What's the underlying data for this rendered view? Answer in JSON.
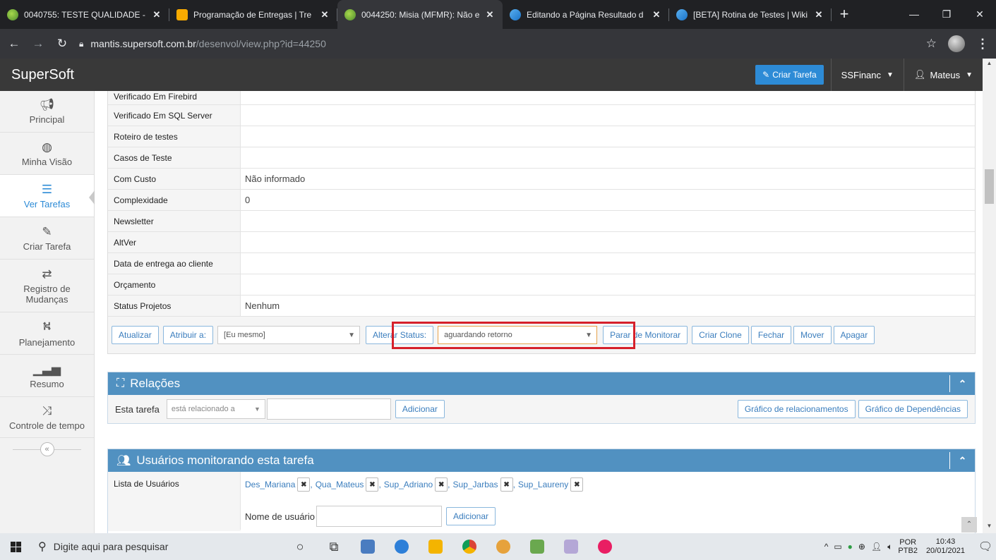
{
  "browser": {
    "tabs": [
      {
        "title": "0040755: TESTE QUALIDADE - N",
        "favicon": "mantis-icon"
      },
      {
        "title": "Programação de Entregas | Tre",
        "favicon": "trello-icon"
      },
      {
        "title": "0044250: Misia (MFMR): Não e",
        "favicon": "mantis-icon",
        "active": true
      },
      {
        "title": "Editando a Página Resultado d",
        "favicon": "wiki-icon"
      },
      {
        "title": "[BETA] Rotina de Testes | Wiki",
        "favicon": "wiki-icon"
      }
    ],
    "new_tab": "+",
    "url_host": "mantis.supersoft.com.br",
    "url_path": "/desenvol/view.php?id=44250"
  },
  "navbar": {
    "brand": "SuperSoft",
    "create_button": "Criar Tarefa",
    "project": "SSFinanc",
    "user": "Mateus"
  },
  "sidebar": {
    "items": [
      {
        "label": "Principal",
        "icon": "megaphone-icon"
      },
      {
        "label": "Minha Visão",
        "icon": "dashboard-icon"
      },
      {
        "label": "Ver Tarefas",
        "icon": "list-icon",
        "active": true
      },
      {
        "label": "Criar Tarefa",
        "icon": "edit-icon"
      },
      {
        "label": "Registro de Mudanças",
        "icon": "retweet-icon"
      },
      {
        "label": "Planejamento",
        "icon": "road-icon"
      },
      {
        "label": "Resumo",
        "icon": "bar-chart-icon"
      },
      {
        "label": "Controle de tempo",
        "icon": "random-icon"
      }
    ]
  },
  "details": {
    "rows": [
      {
        "label": "Verificado Em Firebird",
        "value": ""
      },
      {
        "label": "Verificado Em SQL Server",
        "value": ""
      },
      {
        "label": "Roteiro de testes",
        "value": ""
      },
      {
        "label": "Casos de Teste",
        "value": ""
      },
      {
        "label": "Com Custo",
        "value": "Não informado"
      },
      {
        "label": "Complexidade",
        "value": "0"
      },
      {
        "label": "Newsletter",
        "value": ""
      },
      {
        "label": "AltVer",
        "value": ""
      },
      {
        "label": "Data de entrega ao cliente",
        "value": ""
      },
      {
        "label": "Orçamento",
        "value": ""
      },
      {
        "label": "Status Projetos",
        "value": "Nenhum"
      }
    ]
  },
  "actions": {
    "update": "Atualizar",
    "assign": "Atribuir a:",
    "assign_value": "[Eu mesmo]",
    "change_status": "Alterar Status:",
    "status_value": "aguardando retorno",
    "stop_monitor": "Parar de Monitorar",
    "clone": "Criar Clone",
    "close": "Fechar",
    "move": "Mover",
    "delete": "Apagar",
    "highlight_color": "#d6202b"
  },
  "relations": {
    "title": "Relações",
    "label": "Esta tarefa",
    "select_value": "está relacionado a",
    "add": "Adicionar",
    "graph_relations": "Gráfico de relacionamentos",
    "graph_dependencies": "Gráfico de Dependências"
  },
  "monitors": {
    "title": "Usuários monitorando esta tarefa",
    "list_label": "Lista de Usuários",
    "users": [
      "Des_Mariana",
      "Qua_Mateus",
      "Sup_Adriano",
      "Sup_Jarbas",
      "Sup_Laureny"
    ],
    "username_label": "Nome de usuário",
    "add": "Adicionar"
  },
  "taskbar": {
    "search_placeholder": "Digite aqui para pesquisar",
    "lang_line1": "POR",
    "lang_line2": "PTB2",
    "time": "10:43",
    "date": "20/01/2021"
  },
  "colors": {
    "accent": "#2d8bd6",
    "widget_header": "#5191c1",
    "navbar": "#393939"
  }
}
